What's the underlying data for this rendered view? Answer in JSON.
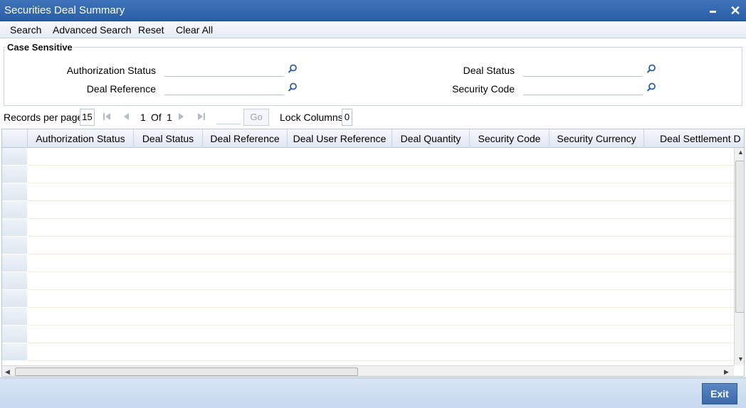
{
  "window": {
    "title": "Securities Deal Summary"
  },
  "menu": {
    "search": "Search",
    "advanced_search": "Advanced Search",
    "reset": "Reset",
    "clear_all": "Clear All"
  },
  "criteria": {
    "legend": "Case Sensitive",
    "authorization_status_label": "Authorization Status",
    "deal_reference_label": "Deal Reference",
    "deal_status_label": "Deal Status",
    "security_code_label": "Security Code",
    "authorization_status_value": "",
    "deal_reference_value": "",
    "deal_status_value": "",
    "security_code_value": ""
  },
  "pager": {
    "records_per_page_label": "Records per page",
    "records_per_page": "15",
    "current_page": "1",
    "of_label": "Of",
    "total_pages": "1",
    "go_label": "Go",
    "lock_columns_label": "Lock Columns",
    "lock_columns": "0"
  },
  "grid": {
    "columns": [
      "Authorization Status",
      "Deal Status",
      "Deal Reference",
      "Deal User Reference",
      "Deal Quantity",
      "Security Code",
      "Security Currency",
      "Deal Settlement D"
    ]
  },
  "footer": {
    "exit_label": "Exit"
  },
  "colors": {
    "title_bar": "#2f63ad",
    "exit_button": "#4a78b8",
    "footer_bg": "#cfdff2"
  },
  "icons": {
    "search_lens": "magnifier-icon"
  }
}
